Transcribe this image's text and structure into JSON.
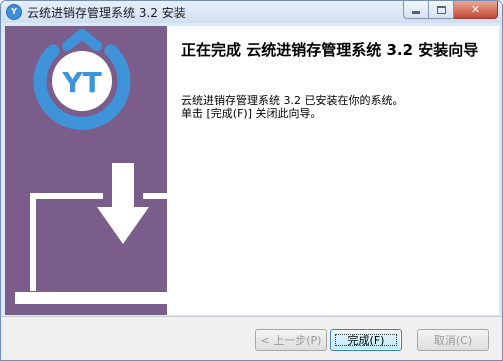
{
  "window": {
    "title": "云统进销存管理系统 3.2 安装",
    "icon_text": "Y",
    "min_icon": "minimize-icon",
    "max_icon": "maximize-icon",
    "close_icon": "close-icon"
  },
  "sidebar": {
    "logo_text": "YT",
    "logo_color": "#3f94d9",
    "background": "#7a5d8a",
    "illustration": "download-laptop-icon"
  },
  "main": {
    "heading": "正在完成 云统进销存管理系统 3.2 安装向导",
    "line1": "云统进销存管理系统 3.2 已安装在你的系统。",
    "line2": "单击 [完成(F)] 关闭此向导。"
  },
  "buttons": {
    "back": "< 上一步(P)",
    "finish": "完成(F)",
    "cancel": "取消(C)"
  }
}
